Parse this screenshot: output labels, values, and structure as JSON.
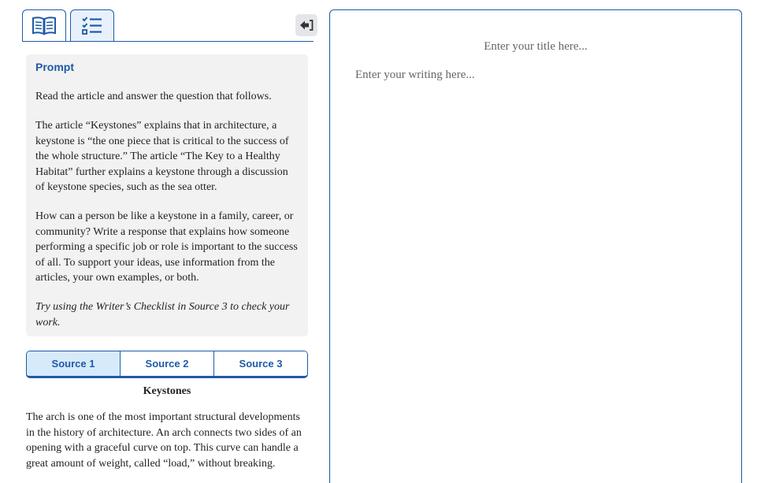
{
  "toolbar": {
    "tabs": [
      {
        "icon": "book-icon"
      },
      {
        "icon": "checklist-icon"
      }
    ],
    "collapse_icon": "collapse-panel-icon"
  },
  "prompt": {
    "heading": "Prompt",
    "paragraphs": [
      "Read the article and answer the question that follows.",
      "The article “Keystones” explains that in architecture, a keystone is “the one piece that is critical to the success of the whole structure.” The article “The Key to a Healthy Habitat” further explains a keystone through a discussion of keystone species, such as the sea otter.",
      "How can a person be like a keystone in a family, career, or community? Write a response that explains how someone performing a specific job or role is important to the success of all. To support your ideas, use information from the articles, your own examples, or both."
    ],
    "note": "Try using the Writer’s Checklist in Source 3 to check your work."
  },
  "sources": {
    "tabs": [
      "Source 1",
      "Source 2",
      "Source 3"
    ],
    "active": 0
  },
  "article": {
    "title": "Keystones",
    "body": "The arch is one of the most important structural developments in the history of architecture. An arch connects two sides of an opening with a graceful curve on top. This curve can handle a great amount of weight, called “load,” without breaking."
  },
  "editor": {
    "title_placeholder": "Enter your title here...",
    "body_placeholder": "Enter your writing here..."
  },
  "colors": {
    "accent": "#1f5aa6",
    "active_tab": "#d6eafb",
    "prompt_bg": "#f2f2f2"
  }
}
